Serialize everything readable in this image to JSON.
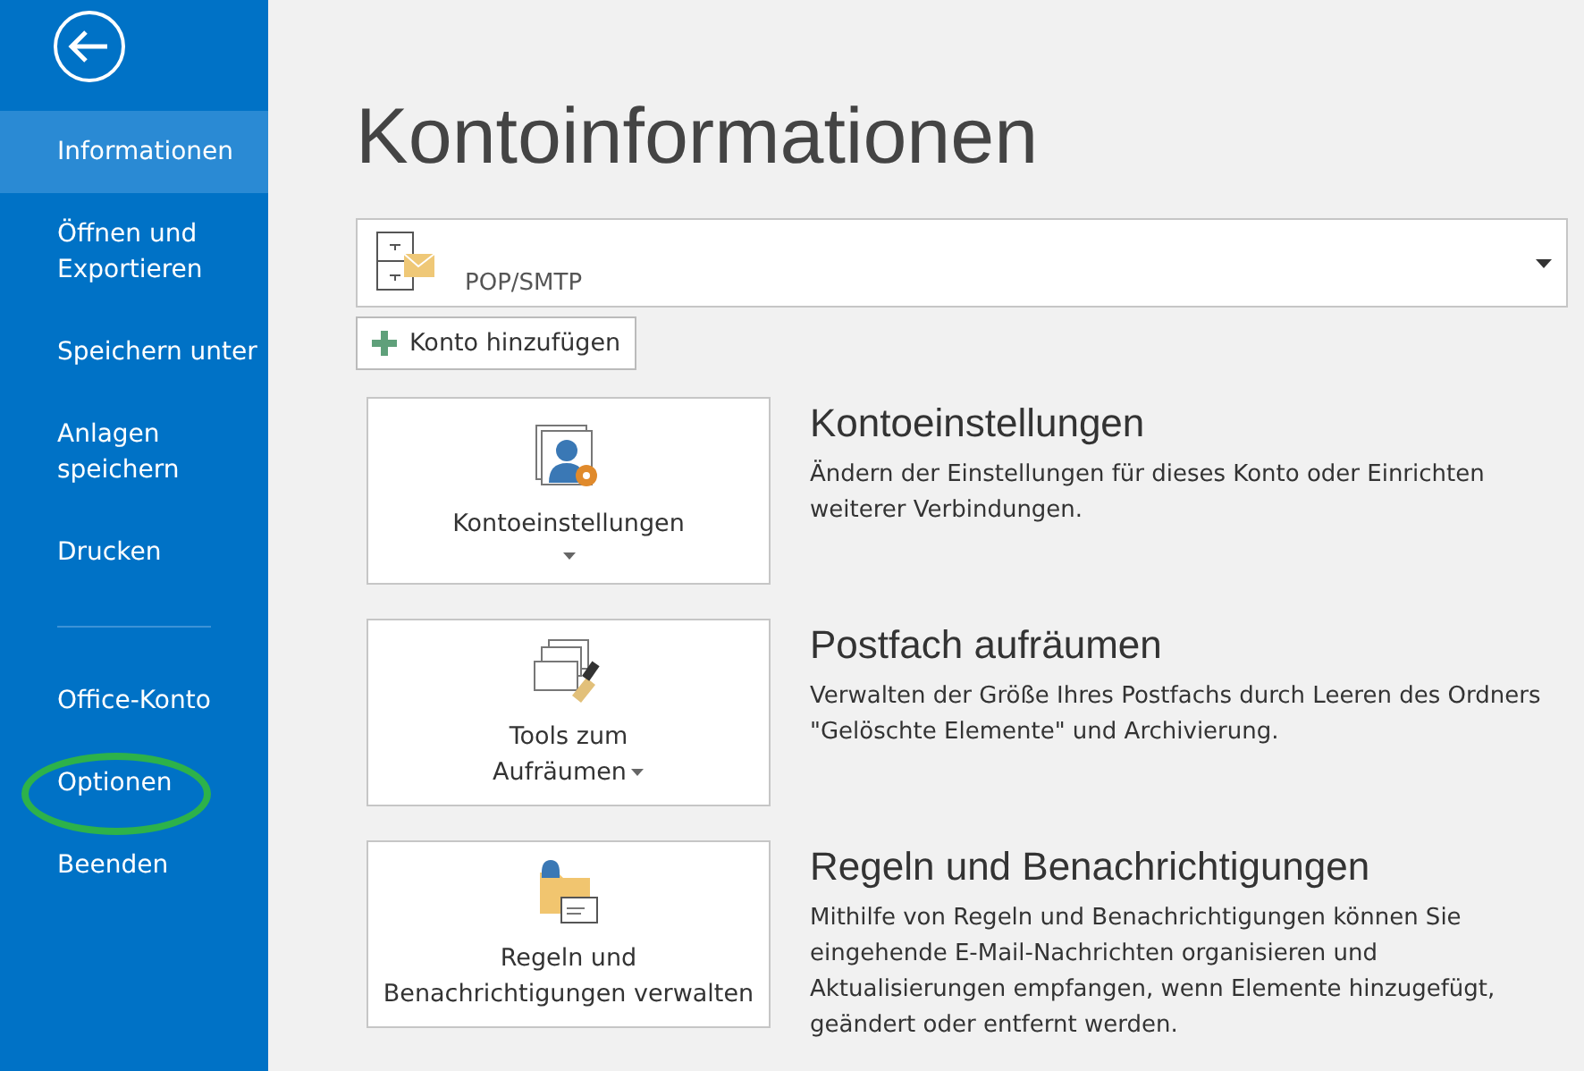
{
  "sidebar": {
    "items": [
      {
        "label": "Informationen",
        "selected": true,
        "circled": false
      },
      {
        "label": "Öffnen und Exportieren",
        "selected": false,
        "circled": false
      },
      {
        "label": "Speichern unter",
        "selected": false,
        "circled": false
      },
      {
        "label": "Anlagen speichern",
        "selected": false,
        "circled": false
      },
      {
        "label": "Drucken",
        "selected": false,
        "circled": false
      },
      {
        "kind": "divider"
      },
      {
        "label": "Office-Konto",
        "selected": false,
        "circled": false
      },
      {
        "label": "Optionen",
        "selected": false,
        "circled": true
      },
      {
        "label": "Beenden",
        "selected": false,
        "circled": false
      }
    ]
  },
  "title": "Kontoinformationen",
  "account": {
    "type": "POP/SMTP"
  },
  "add_account_button": "Konto hinzufügen",
  "sections": [
    {
      "button": [
        "Kontoeinstellungen"
      ],
      "kind": "split",
      "heading": "Kontoeinstellungen",
      "description": "Ändern der Einstellungen für dieses Konto oder Einrichten weiterer Verbindungen."
    },
    {
      "button": [
        "Tools zum",
        "Aufräumen"
      ],
      "kind": "dropdown",
      "heading": "Postfach aufräumen",
      "description": "Verwalten der Größe Ihres Postfachs durch Leeren des Ordners \"Gelöschte Elemente\" und Archivierung."
    },
    {
      "button": [
        "Regeln und",
        "Benachrichtigungen verwalten"
      ],
      "kind": "plain",
      "heading": "Regeln und Benachrichtigungen",
      "description": "Mithilfe von Regeln und Benachrichtigungen können Sie eingehende E-Mail-Nachrichten organisieren und Aktualisierungen empfangen, wenn Elemente hinzugefügt, geändert oder entfernt werden."
    }
  ]
}
